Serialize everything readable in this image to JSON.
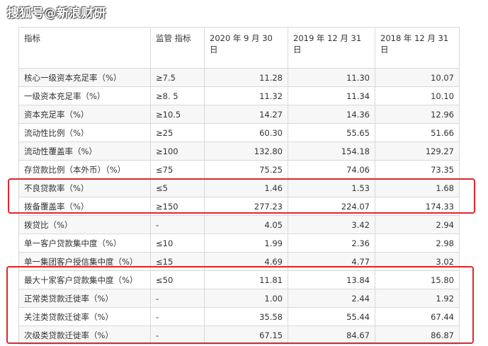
{
  "watermark": "搜狐号@新浪财研",
  "header": {
    "indicator": "指标",
    "regulatory": "监管 指标",
    "col2020": "2020 年 9 月 30 日",
    "col2019": "2019 年 12 月 31 日",
    "col2018": "2018 年 12 月 31 日"
  },
  "rows": [
    {
      "name": "核心一级资本充足率（%）",
      "reg": "≥7.5",
      "v2020": "11.28",
      "v2019": "11.30",
      "v2018": "10.07"
    },
    {
      "name": "一级资本充足率（%）",
      "reg": "≥8. 5",
      "v2020": "11.32",
      "v2019": "11.34",
      "v2018": "10.10"
    },
    {
      "name": "资本充足率（%）",
      "reg": "≥10.5",
      "v2020": "14.27",
      "v2019": "14.36",
      "v2018": "12.96"
    },
    {
      "name": "流动性比例（%）",
      "reg": "≥25",
      "v2020": "60.30",
      "v2019": "55.65",
      "v2018": "51.66"
    },
    {
      "name": "流动性覆盖率（%）",
      "reg": "≥100",
      "v2020": "132.80",
      "v2019": "154.18",
      "v2018": "129.27"
    },
    {
      "name": "存贷款比例（本外币）（%）",
      "reg": "≤75",
      "v2020": "75.25",
      "v2019": "74.06",
      "v2018": "73.35"
    },
    {
      "name": "不良贷款率（%）",
      "reg": "≤5",
      "v2020": "1.46",
      "v2019": "1.53",
      "v2018": "1.68"
    },
    {
      "name": "拨备覆盖率（%）",
      "reg": "≥150",
      "v2020": "277.23",
      "v2019": "224.07",
      "v2018": "174.33"
    },
    {
      "name": "拨贷比（%）",
      "reg": "-",
      "v2020": "4.05",
      "v2019": "3.42",
      "v2018": "2.94"
    },
    {
      "name": "单一客户贷款集中度（%）",
      "reg": "≤10",
      "v2020": "1.99",
      "v2019": "2.36",
      "v2018": "2.98"
    },
    {
      "name": "单一集团客户授信集中度（%）",
      "reg": "≤15",
      "v2020": "4.69",
      "v2019": "4.77",
      "v2018": "3.02"
    },
    {
      "name": "最大十家客户贷款集中度（%）",
      "reg": "≤50",
      "v2020": "11.81",
      "v2019": "13.84",
      "v2018": "15.80"
    },
    {
      "name": "正常类贷款迁徙率（%）",
      "reg": "-",
      "v2020": "1.00",
      "v2019": "2.44",
      "v2018": "1.92"
    },
    {
      "name": "关注类贷款迁徙率（%）",
      "reg": "-",
      "v2020": "35.58",
      "v2019": "55.44",
      "v2018": "67.44"
    },
    {
      "name": "次级类贷款迁徙率（%）",
      "reg": "-",
      "v2020": "67.15",
      "v2019": "84.67",
      "v2018": "86.87"
    }
  ],
  "highlight_color": "#e0262b"
}
